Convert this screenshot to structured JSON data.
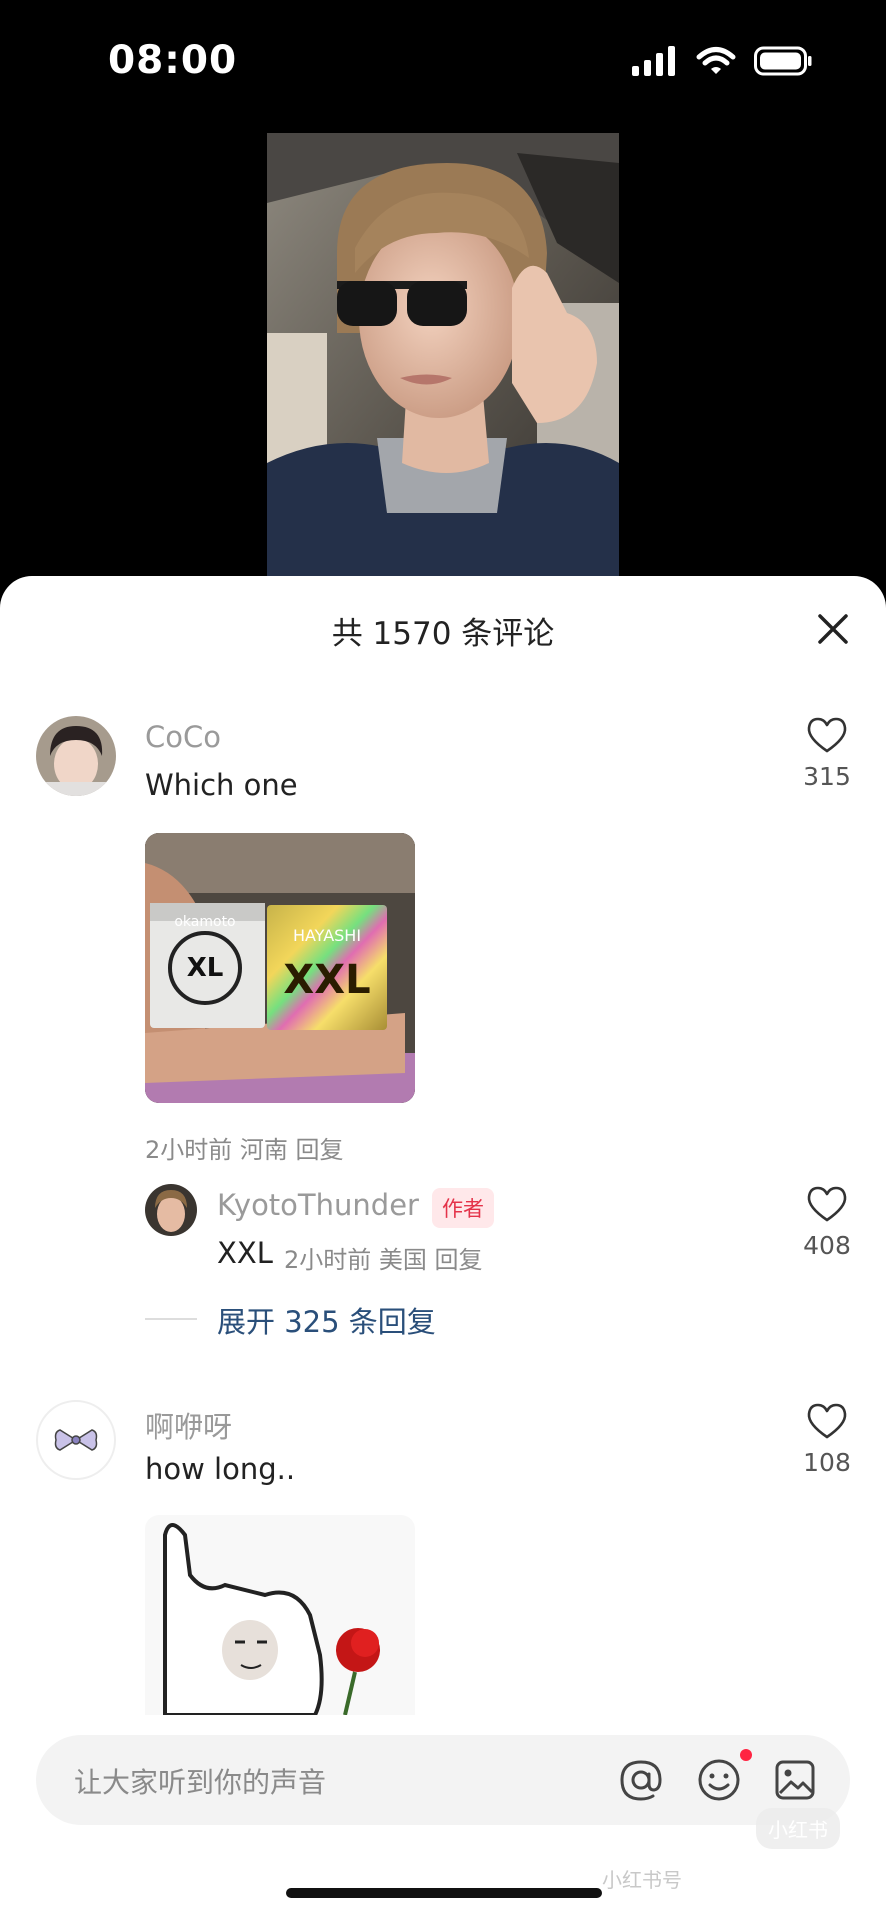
{
  "status_bar": {
    "time": "08:00"
  },
  "comments_sheet": {
    "title": "共 1570 条评论",
    "close_icon": "close-icon",
    "input_placeholder": "让大家听到你的声音",
    "input_icons": [
      "at-icon",
      "emoji-icon",
      "image-icon"
    ]
  },
  "comments": [
    {
      "username": "CoCo",
      "text": "Which one",
      "likes": "315",
      "has_image": true,
      "meta": "2小时前 河南 回复",
      "replies": [
        {
          "username": "KyotoThunder",
          "badge": "作者",
          "text": "XXL",
          "meta": "2小时前 美国 回复",
          "likes": "408"
        }
      ],
      "expand_label": "展开 325 条回复"
    },
    {
      "username": "啊咿呀",
      "text": "how long..",
      "likes": "108",
      "has_image": true
    }
  ],
  "image_text": {
    "box_left_brand": "okamoto",
    "box_left_label": "XL",
    "box_right_brand": "HAYASHI",
    "box_right_label": "XXL"
  },
  "watermark": {
    "logo": "小红书",
    "account": "小红书号"
  },
  "colors": {
    "author_badge_bg": "#ffe8ea",
    "author_badge_text": "#e4334a",
    "expand_text": "#2a4f7a",
    "notification_dot": "#ff2442"
  }
}
